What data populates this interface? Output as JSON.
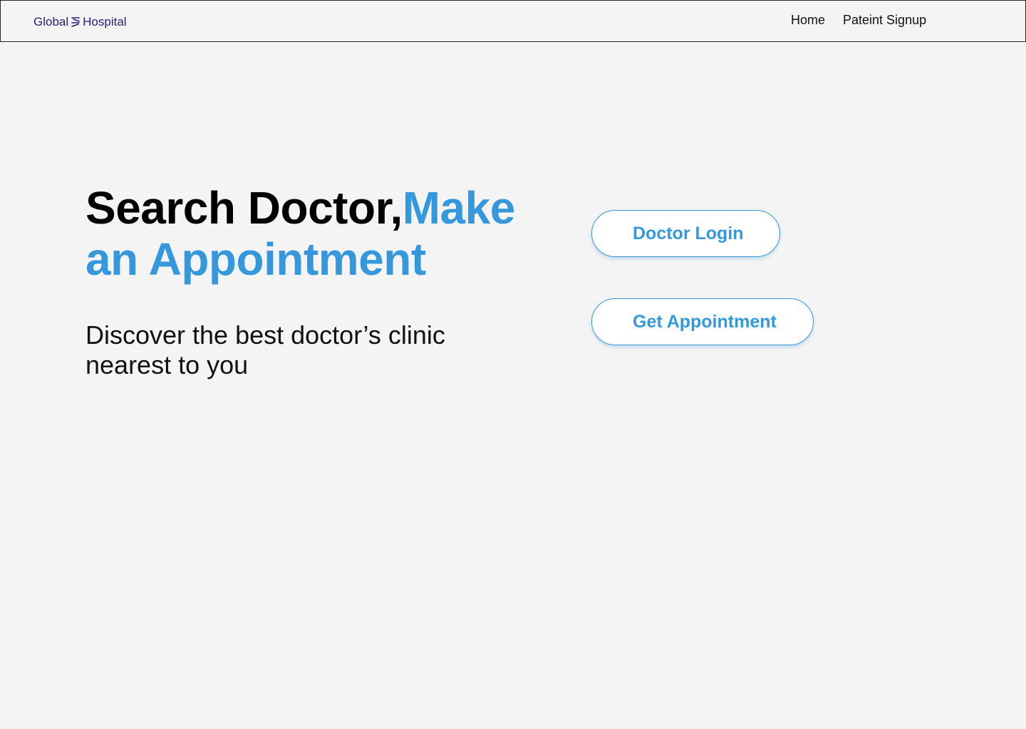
{
  "brand": {
    "left": "Global",
    "right": "Hospital",
    "logo_icon": "brand-wave-icon",
    "color": "#26217a"
  },
  "nav": {
    "home": "Home",
    "signup": "Pateint Signup"
  },
  "hero": {
    "title_part1": "Search Doctor,",
    "title_part2": "Make an Appointment",
    "subtitle": "Discover the best doctor’s clinic nearest to you"
  },
  "actions": {
    "doctor_login": "Doctor Login",
    "get_appointment": "Get Appointment"
  },
  "colors": {
    "accent": "#3598dc",
    "background": "#f4f4f4",
    "text": "#000000"
  }
}
